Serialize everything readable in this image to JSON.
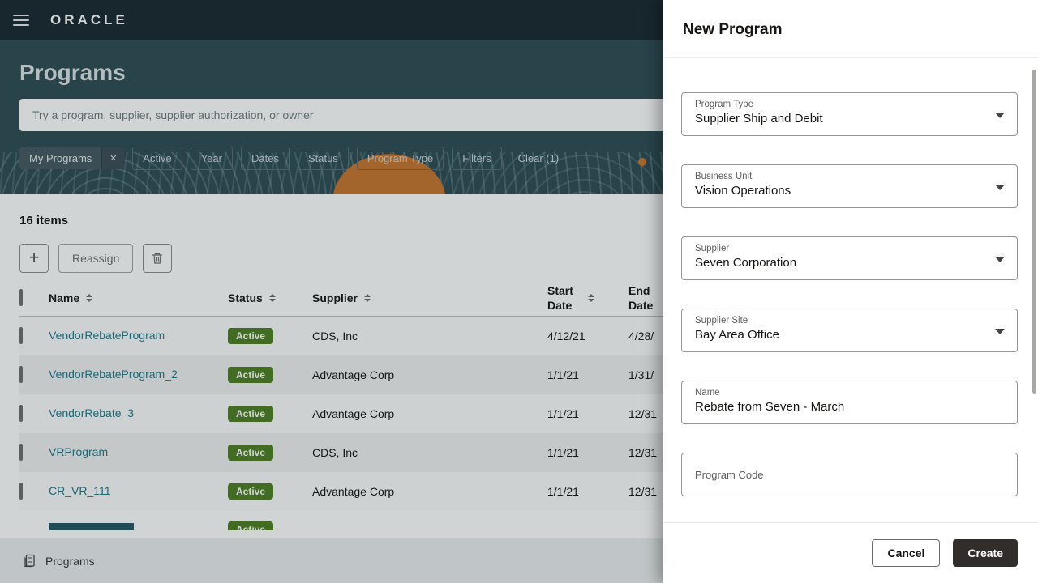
{
  "topbar": {
    "brand": "ORACLE"
  },
  "page": {
    "title": "Programs",
    "search": {
      "placeholder": "Try a program, supplier, supplier authorization, or owner"
    },
    "filters": {
      "selected_chip": "My Programs",
      "chips": [
        "Active",
        "Year",
        "Dates",
        "Status",
        "Program Type",
        "Filters"
      ],
      "clear_label": "Clear (1)"
    },
    "items_count": "16 items",
    "toolbar": {
      "reassign_label": "Reassign"
    },
    "table": {
      "columns": [
        "Name",
        "Status",
        "Supplier",
        "Start Date",
        "End Date"
      ],
      "rows": [
        {
          "name": "VendorRebateProgram",
          "status": "Active",
          "supplier": "CDS, Inc",
          "start_date": "4/12/21",
          "end_date": "4/28/"
        },
        {
          "name": "VendorRebateProgram_2",
          "status": "Active",
          "supplier": "Advantage Corp",
          "start_date": "1/1/21",
          "end_date": "1/31/"
        },
        {
          "name": "VendorRebate_3",
          "status": "Active",
          "supplier": "Advantage Corp",
          "start_date": "1/1/21",
          "end_date": "12/31"
        },
        {
          "name": "VRProgram",
          "status": "Active",
          "supplier": "CDS, Inc",
          "start_date": "1/1/21",
          "end_date": "12/31"
        },
        {
          "name": "CR_VR_111",
          "status": "Active",
          "supplier": "Advantage Corp",
          "start_date": "1/1/21",
          "end_date": "12/31"
        }
      ],
      "partial_row_status": "Active"
    },
    "footer": {
      "label": "Programs"
    }
  },
  "panel": {
    "title": "New Program",
    "fields": [
      {
        "label": "Program Type",
        "value": "Supplier Ship and Debit",
        "type": "select"
      },
      {
        "label": "Business Unit",
        "value": "Vision Operations",
        "type": "select"
      },
      {
        "label": "Supplier",
        "value": "Seven Corporation",
        "type": "select"
      },
      {
        "label": "Supplier Site",
        "value": "Bay Area Office",
        "type": "select"
      },
      {
        "label": "Name",
        "value": "Rebate from Seven - March",
        "type": "text"
      },
      {
        "label": "Program Code",
        "value": "",
        "type": "text"
      }
    ],
    "actions": {
      "cancel_label": "Cancel",
      "create_label": "Create"
    }
  },
  "colors": {
    "topbar_bg": "#1a262e",
    "hero_bg": "#2f4a53",
    "badge_green": "#4f7d21",
    "link_teal": "#1f7a8c",
    "create_button_bg": "#312d2a",
    "accent_orange": "#c8752c"
  }
}
